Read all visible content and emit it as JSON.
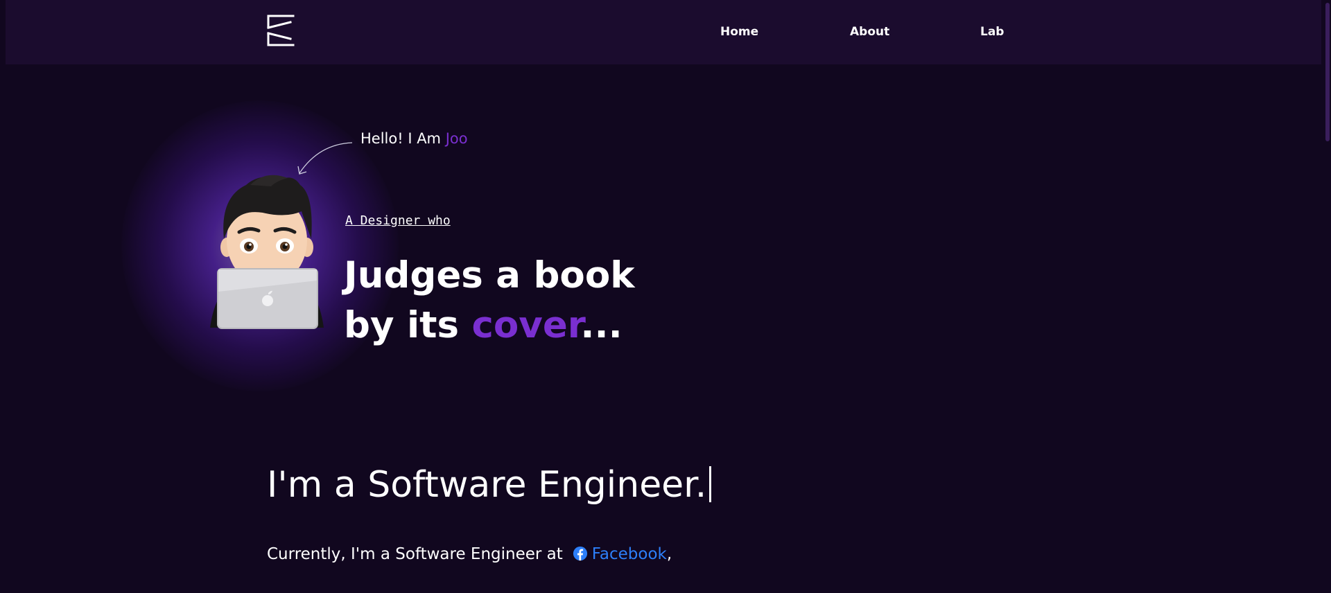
{
  "header": {
    "logo_icon": "k-monogram-logo-icon",
    "nav": [
      {
        "label": "Home"
      },
      {
        "label": "About"
      },
      {
        "label": "Lab"
      }
    ]
  },
  "hero": {
    "greeting_prefix": "Hello! I Am ",
    "greeting_name": "Joo",
    "tagline": "A Designer who",
    "headline_line1": "Judges a book",
    "headline_line2_prefix": "by its ",
    "headline_line2_accent": "cover",
    "headline_line2_suffix": "...",
    "avatar_icon": "memoji-with-laptop-icon"
  },
  "intro": {
    "role_text": "I'm a Software Engineer.",
    "currently_prefix": "Currently, I'm a Software Engineer at",
    "company": "Facebook",
    "company_icon": "facebook-icon",
    "trailing": ","
  },
  "colors": {
    "background": "#11071f",
    "header_bg": "#1b0c2e",
    "accent": "#7a2fd0",
    "link_blue": "#2d7ff9"
  }
}
